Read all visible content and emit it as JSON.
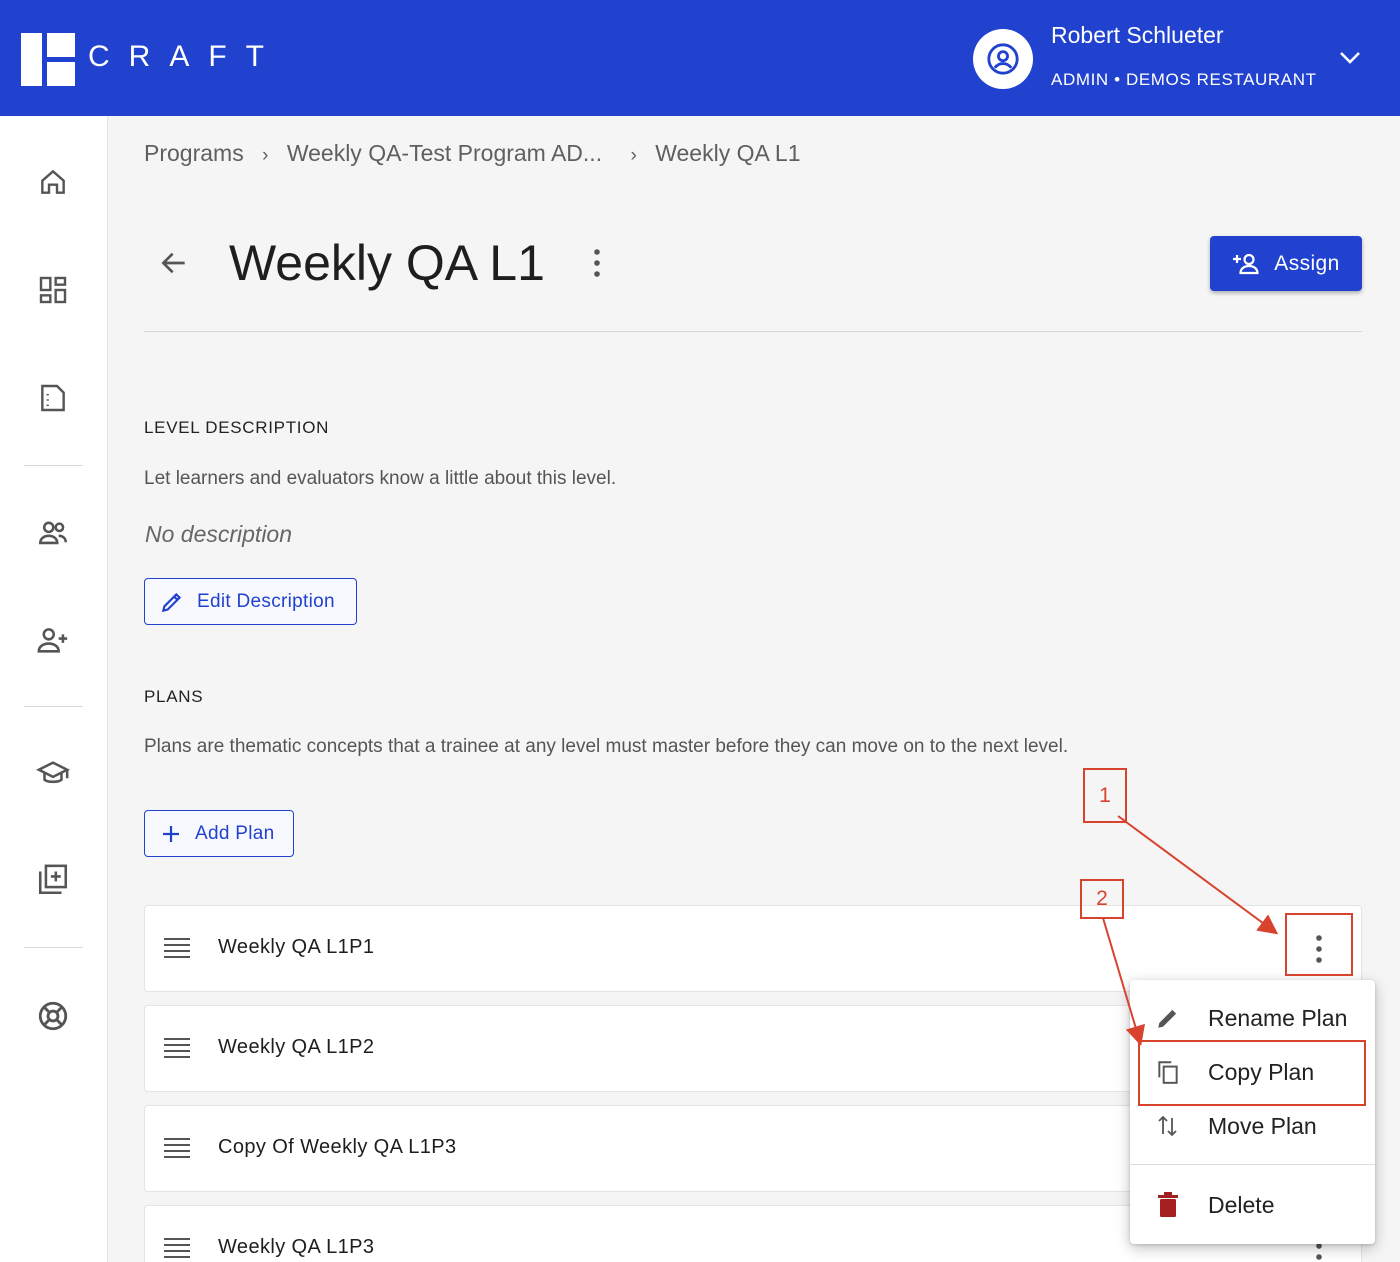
{
  "brand": {
    "logo_text": "CRAFT"
  },
  "user": {
    "name": "Robert Schlueter",
    "role": "ADMIN • DEMOS RESTAURANT"
  },
  "breadcrumb": {
    "items": [
      "Programs",
      "Weekly QA-Test Program AD...",
      "Weekly QA L1"
    ],
    "separator": "›"
  },
  "page": {
    "title": "Weekly QA L1",
    "assign_label": "Assign"
  },
  "level_description": {
    "heading": "LEVEL DESCRIPTION",
    "help": "Let learners and evaluators know a little about this level.",
    "empty": "No description",
    "edit_label": "Edit Description"
  },
  "plans": {
    "heading": "PLANS",
    "help": "Plans are thematic concepts that a trainee at any level must master before they can move on to the next level.",
    "add_label": "Add Plan",
    "items": [
      "Weekly QA L1P1",
      "Weekly QA L1P2",
      "Copy Of Weekly QA L1P3",
      "Weekly QA L1P3"
    ]
  },
  "plan_menu": {
    "items": [
      "Rename Plan",
      "Copy Plan",
      "Move Plan",
      "Delete"
    ]
  },
  "annotations": {
    "labels": [
      "1",
      "2"
    ],
    "color": "#d8432e"
  },
  "colors": {
    "primary": "#2141cf",
    "danger": "#a32020"
  },
  "icons": {
    "sidebar": [
      "home-icon",
      "dashboard-icon",
      "document-icon",
      "people-icon",
      "add-person-icon",
      "school-icon",
      "library-add-icon",
      "lifebuoy-icon"
    ]
  }
}
